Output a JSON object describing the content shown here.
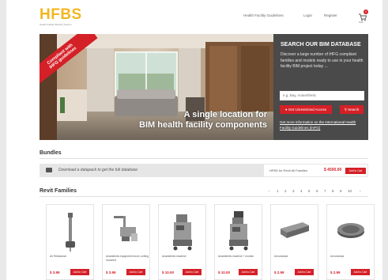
{
  "header": {
    "logo": "HFBS",
    "tagline": "Health Facility Briefing System",
    "nav": [
      "Health Facility Guidelines",
      "Login",
      "Register"
    ],
    "cart_count": "0",
    "cart_label": "Cart"
  },
  "hero": {
    "ribbon_line1": "Compliant with",
    "ribbon_line2": "iHFG guidelines",
    "caption_line1": "A single location for",
    "caption_line2": "BIM health facility components"
  },
  "search_panel": {
    "title": "SEARCH OUR BIM DATABASE",
    "description": "Discover a large number of iHFG compliant families and models ready to use in your health facility BIM project today ...",
    "input_placeholder": "e.g. Bay, Anaesthetic",
    "unrestricted_button": "Get Unrestricted Access",
    "search_button": "Search",
    "link": "Get more information on the International Health Facility Guidelines (iHFG)"
  },
  "bundles": {
    "title": "Bundles",
    "bar_text": "Download a datapack to get the full database",
    "bundle_name": "HFBS for Revit All Families",
    "bundle_price": "$ 4500.00",
    "add_label": "Add to Cart"
  },
  "revit": {
    "title": "Revit Families",
    "pages": [
      "‹",
      "1",
      "2",
      "3",
      "4",
      "5",
      "6",
      "7",
      "8",
      "9",
      "10",
      "›"
    ],
    "products": [
      {
        "name": "Air Resistance",
        "price": "$ 3.99",
        "add_label": "Add to Cart"
      },
      {
        "name": "Anaesthetic equipment boom, ceiling mounted",
        "price": "$ 3.99",
        "add_label": "Add to Cart"
      },
      {
        "name": "Anaesthetic machine",
        "price": "$ 10.00",
        "add_label": "Add to Cart"
      },
      {
        "name": "Anaesthetic machine + monitor",
        "price": "$ 10.00",
        "add_label": "Add to Cart"
      },
      {
        "name": "Annunciator",
        "price": "$ 2.99",
        "add_label": "Add to Cart"
      },
      {
        "name": "Annunciator",
        "price": "$ 2.99",
        "add_label": "Add to Cart"
      }
    ]
  },
  "colors": {
    "accent": "#d42027",
    "logo": "#f3b61f",
    "panel": "#4a4a4a"
  }
}
